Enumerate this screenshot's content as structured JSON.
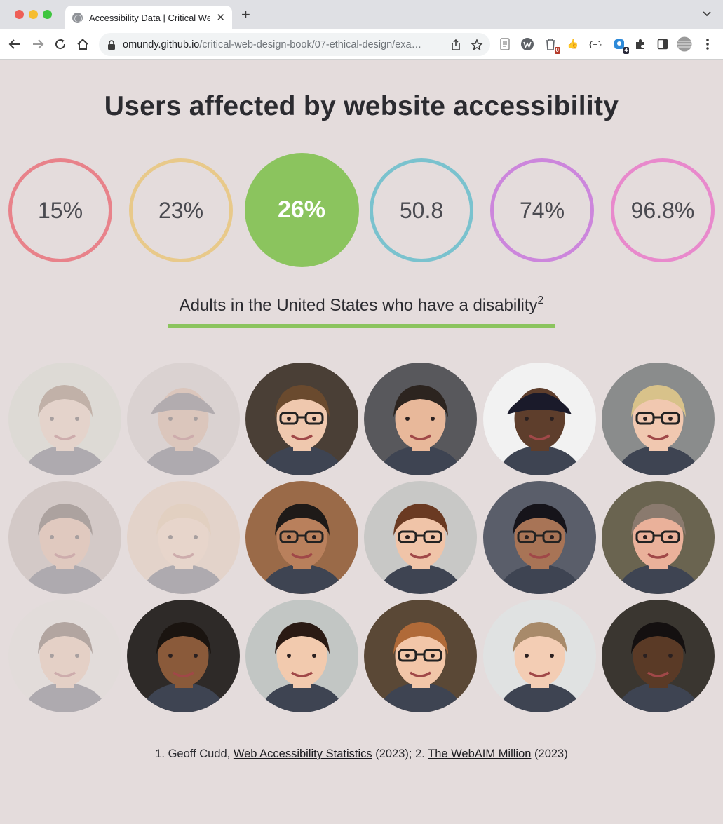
{
  "browser": {
    "tab_title": "Accessibility Data | Critical We",
    "url_host": "omundy.github.io",
    "url_path": "/critical-web-design-book/07-ethical-design/exa…",
    "extension_badges": [
      "0",
      "4"
    ]
  },
  "page": {
    "title": "Users affected by website accessibility",
    "stats": [
      {
        "label": "15%",
        "color": "#e8828a",
        "active": false
      },
      {
        "label": "23%",
        "color": "#e8c98a",
        "active": false
      },
      {
        "label": "26%",
        "color": "#8bc45e",
        "active": true
      },
      {
        "label": "50.8",
        "color": "#7ac2ce",
        "active": false
      },
      {
        "label": "74%",
        "color": "#cc86dc",
        "active": false
      },
      {
        "label": "96.8%",
        "color": "#e889cc",
        "active": false
      }
    ],
    "subtitle": "Adults in the United States who have a disability",
    "subtitle_sup": "2",
    "accent": "#8bc45e",
    "faces": [
      {
        "skin": "#e5c3a8",
        "hair": "#7a5a3c",
        "bg": "#cfd6c8",
        "dim": true,
        "glasses": false,
        "hat": false
      },
      {
        "skin": "#c99a7a",
        "hair": "#4b4854",
        "bg": "#c7c0bd",
        "dim": true,
        "glasses": false,
        "hat": true
      },
      {
        "skin": "#efc8ae",
        "hair": "#6a4a2e",
        "bg": "#4a3f36",
        "dim": false,
        "glasses": true,
        "hat": false
      },
      {
        "skin": "#e8b89a",
        "hair": "#2c241f",
        "bg": "#58585c",
        "dim": false,
        "glasses": false,
        "hat": false
      },
      {
        "skin": "#5e3e2c",
        "hair": "#1a1a2a",
        "bg": "#f2f2f2",
        "dim": false,
        "glasses": false,
        "hat": true
      },
      {
        "skin": "#f1c8b0",
        "hair": "#d8c28a",
        "bg": "#8a8c8c",
        "dim": false,
        "glasses": true,
        "hat": false
      },
      {
        "skin": "#d9a285",
        "hair": "#3a2a22",
        "bg": "#b0a49c",
        "dim": true,
        "glasses": false,
        "hat": false
      },
      {
        "skin": "#f0c8a8",
        "hair": "#e0b88a",
        "bg": "#e2c2a6",
        "dim": true,
        "glasses": false,
        "hat": false
      },
      {
        "skin": "#b9805c",
        "hair": "#1e1a18",
        "bg": "#9a6a48",
        "dim": false,
        "glasses": true,
        "hat": false
      },
      {
        "skin": "#f0c4a8",
        "hair": "#6a3a22",
        "bg": "#c8c8c6",
        "dim": false,
        "glasses": true,
        "hat": false
      },
      {
        "skin": "#a87456",
        "hair": "#16141a",
        "bg": "#5a5e6a",
        "dim": false,
        "glasses": true,
        "hat": false
      },
      {
        "skin": "#eab19a",
        "hair": "#8a7a6e",
        "bg": "#6a6450",
        "dim": false,
        "glasses": true,
        "hat": false
      },
      {
        "skin": "#e6b89a",
        "hair": "#4a3426",
        "bg": "#e0dcd8",
        "dim": true,
        "glasses": false,
        "hat": false
      },
      {
        "skin": "#8a5a3a",
        "hair": "#1a1410",
        "bg": "#2e2a28",
        "dim": false,
        "glasses": false,
        "hat": false
      },
      {
        "skin": "#f2caae",
        "hair": "#2a1a14",
        "bg": "#c2c6c4",
        "dim": false,
        "glasses": false,
        "hat": false
      },
      {
        "skin": "#f2c6a8",
        "hair": "#b06a38",
        "bg": "#5a4836",
        "dim": false,
        "glasses": true,
        "hat": false
      },
      {
        "skin": "#f3cdb4",
        "hair": "#a88a6a",
        "bg": "#e0e2e2",
        "dim": false,
        "glasses": false,
        "hat": false
      },
      {
        "skin": "#5a3a26",
        "hair": "#141010",
        "bg": "#3a3630",
        "dim": false,
        "glasses": false,
        "hat": false
      }
    ],
    "footnote": {
      "prefix1": "1. Geoff Cudd, ",
      "link1": "Web Accessibility Statistics",
      "mid": " (2023); 2. ",
      "link2": "The WebAIM Million",
      "suffix": " (2023)"
    }
  }
}
